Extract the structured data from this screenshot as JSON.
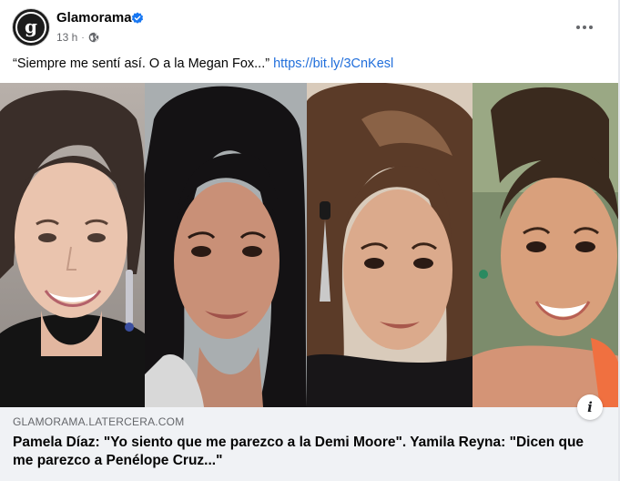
{
  "post": {
    "page_name": "Glamorama",
    "avatar_letter": "g",
    "timestamp": "13 h",
    "separator": "·",
    "audience_icon": "globe-icon",
    "verified_icon": "verified-badge-icon",
    "more_icon": "more-options-icon",
    "caption_text": "“Siempre me sentí así. O a la Megan Fox...” ",
    "caption_link": "https://bit.ly/3CnKesl"
  },
  "link_preview": {
    "domain": "GLAMORAMA.LATERCERA.COM",
    "headline": "Pamela Díaz: \"Yo siento que me parezco a la Demi Moore\". Yamila Reyna: \"Dicen que me parezco a Penélope Cruz...\"",
    "info_icon_label": "i"
  },
  "colors": {
    "link": "#216fdb",
    "verified": "#1877f2",
    "secondary_text": "#65676b",
    "footer_bg": "#f0f2f5"
  }
}
